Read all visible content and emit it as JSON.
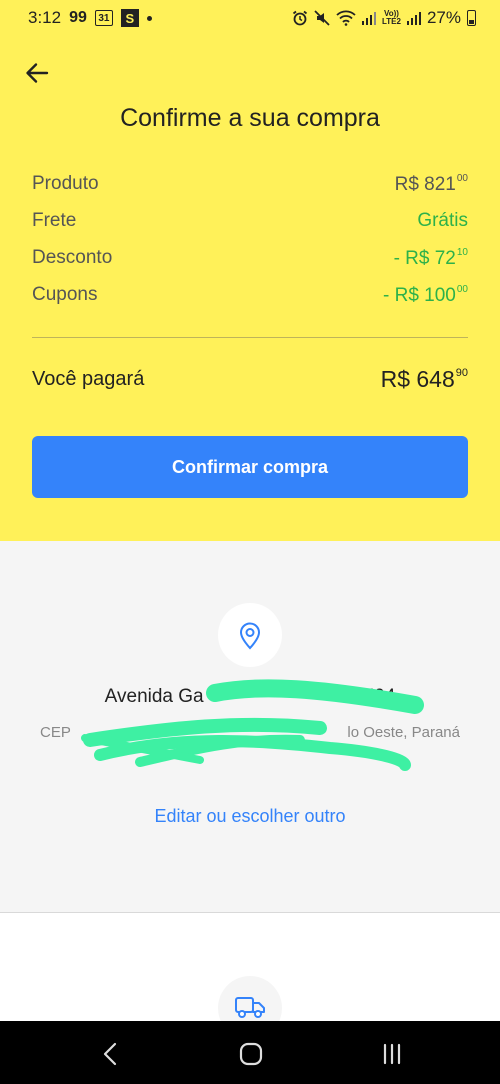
{
  "status_bar": {
    "time": "3:12",
    "badge_99": "99",
    "calendar_day": "31",
    "s_icon": "S",
    "lte_label_top": "Vo))",
    "lte_label_bottom": "LTE2",
    "battery": "27%"
  },
  "header": {
    "title": "Confirme a sua compra",
    "rows": [
      {
        "label": "Produto",
        "value": "R$ 821",
        "cents": "00"
      },
      {
        "label": "Frete",
        "value": "Grátis",
        "cents": ""
      },
      {
        "label": "Desconto",
        "value": "- R$ 72",
        "cents": "10"
      },
      {
        "label": "Cupons",
        "value": "- R$ 100",
        "cents": "00"
      }
    ],
    "total_label": "Você pagará",
    "total_value": "R$ 648",
    "total_cents": "90",
    "confirm_label": "Confirmar compra"
  },
  "address": {
    "line1": "Avenida Ga",
    "line1_end": "594",
    "line2_start": "CEP",
    "line2_end": "lo Oeste, Paraná",
    "edit_link": "Editar ou escolher outro"
  },
  "icons": {
    "back": "arrow-left-icon",
    "pin": "location-pin-icon",
    "truck": "truck-icon"
  },
  "colors": {
    "header_bg": "#fff159",
    "primary": "#3483fa",
    "green": "#2db14a",
    "redaction": "#3ef0a3"
  }
}
